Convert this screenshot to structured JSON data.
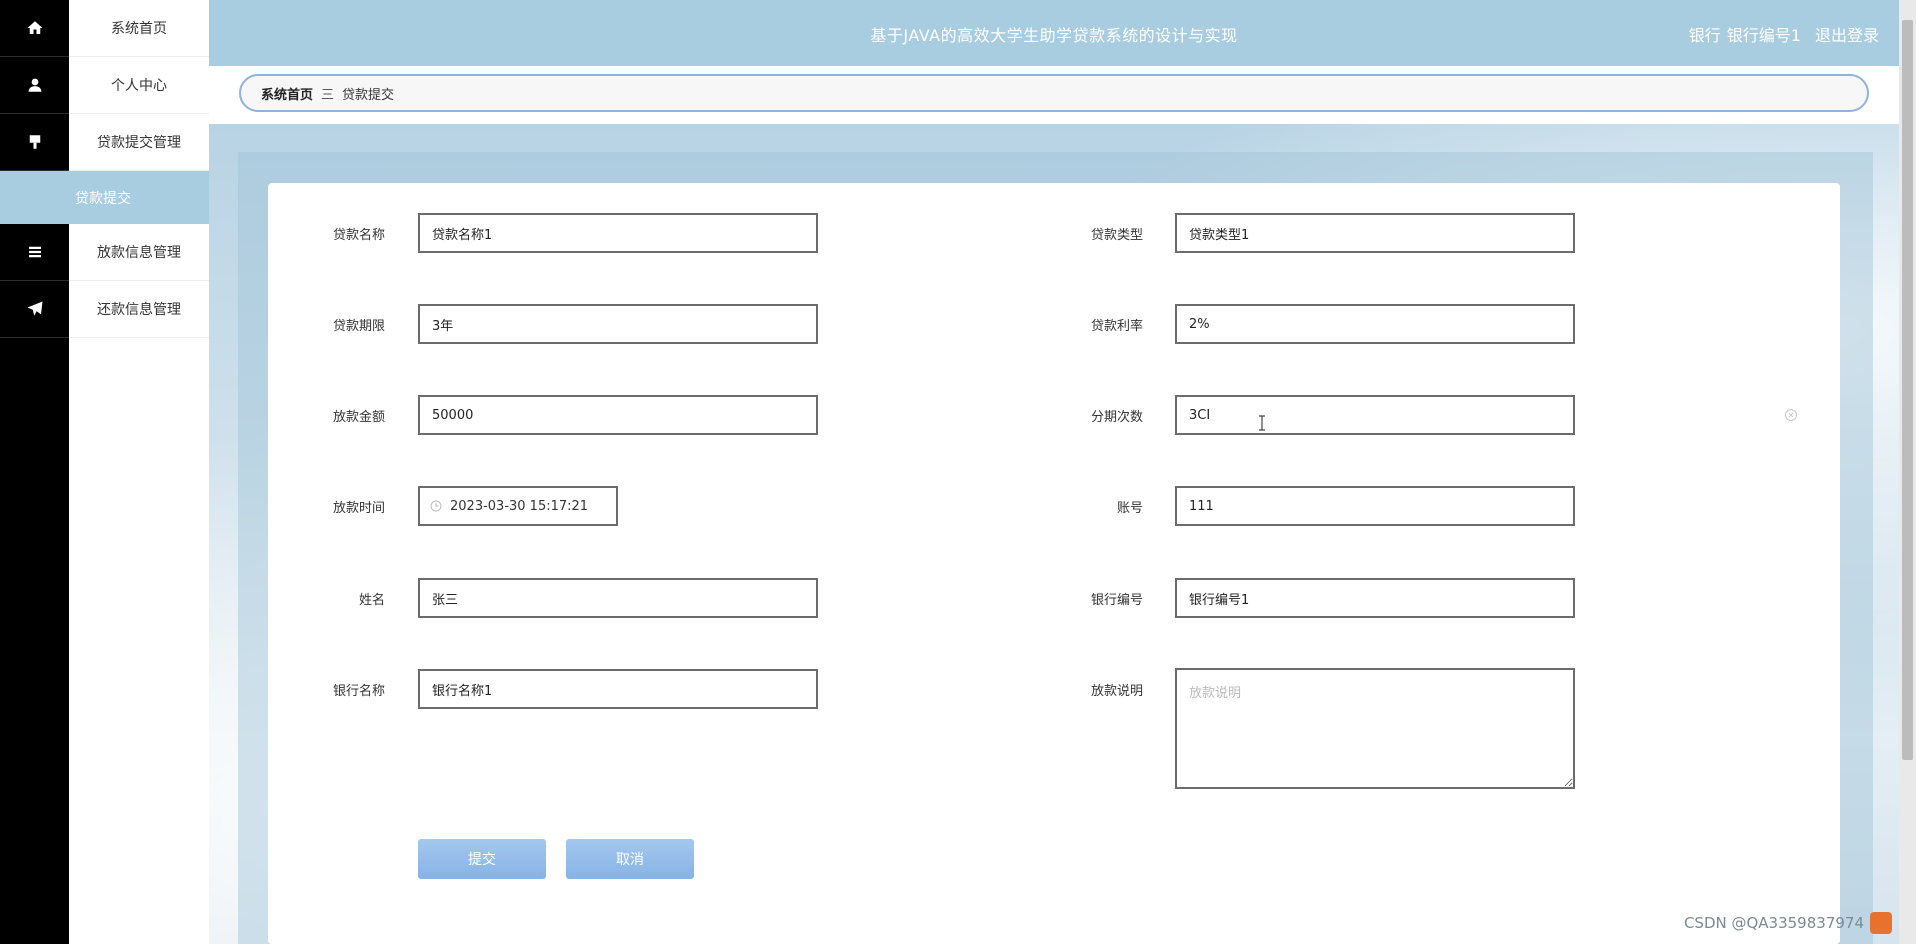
{
  "header": {
    "title": "基于JAVA的高效大学生助学贷款系统的设计与实现",
    "user_role": "银行",
    "user_name": "银行编号1",
    "logout_label": "退出登录"
  },
  "menu": {
    "items": [
      {
        "label": "系统首页",
        "icon": "home-icon"
      },
      {
        "label": "个人中心",
        "icon": "user-icon"
      },
      {
        "label": "贷款提交管理",
        "icon": "flag-icon"
      },
      {
        "label": "贷款提交",
        "icon": ""
      },
      {
        "label": "放款信息管理",
        "icon": "list-icon"
      },
      {
        "label": "还款信息管理",
        "icon": "send-icon"
      }
    ]
  },
  "breadcrumb": {
    "home": "系统首页",
    "separator": "三",
    "current": "贷款提交"
  },
  "form": {
    "loan_name": {
      "label": "贷款名称",
      "value": "贷款名称1"
    },
    "loan_type": {
      "label": "贷款类型",
      "value": "贷款类型1"
    },
    "loan_term": {
      "label": "贷款期限",
      "value": "3年"
    },
    "loan_rate": {
      "label": "贷款利率",
      "value": "2%"
    },
    "loan_amount": {
      "label": "放款金额",
      "value": "50000"
    },
    "installments": {
      "label": "分期次数",
      "value": "3CI"
    },
    "loan_time": {
      "label": "放款时间",
      "value": "2023-03-30 15:17:21"
    },
    "account": {
      "label": "账号",
      "value": "111"
    },
    "name": {
      "label": "姓名",
      "value": "张三"
    },
    "bank_code": {
      "label": "银行编号",
      "value": "银行编号1"
    },
    "bank_name": {
      "label": "银行名称",
      "value": "银行名称1"
    },
    "loan_note": {
      "label": "放款说明",
      "value": "",
      "placeholder": "放款说明"
    }
  },
  "buttons": {
    "submit": "提交",
    "cancel": "取消"
  },
  "watermark": {
    "text": "CSDN @QA3359837974"
  },
  "colors": {
    "header_bg": "#a8cde0",
    "rail_bg": "#000000",
    "button_bg": "#86b3e6",
    "breadcrumb_border": "#8fb3d9"
  }
}
